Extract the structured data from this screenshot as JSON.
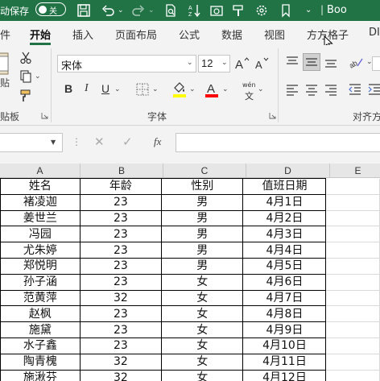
{
  "titlebar": {
    "autosave_label": "动保存",
    "toggle_label": "关",
    "doc_name": "Boo"
  },
  "tabs": [
    {
      "label": "件"
    },
    {
      "label": "开始"
    },
    {
      "label": "插入"
    },
    {
      "label": "页面布局"
    },
    {
      "label": "公式"
    },
    {
      "label": "数据"
    },
    {
      "label": "视图"
    },
    {
      "label": "方方格子"
    },
    {
      "label": "DI"
    }
  ],
  "ribbon": {
    "clipboard_paste": "贴",
    "clipboard_group": "贴板",
    "font_name": "宋体",
    "font_size": "12",
    "font_group": "字体",
    "align_group": "对齐方",
    "phonetic_label": "wén",
    "phonetic_sub": "文"
  },
  "formula_bar": {
    "fx_label": "fx",
    "value": ""
  },
  "columns": [
    "A",
    "B",
    "C",
    "D",
    "E"
  ],
  "table": {
    "headers": [
      "姓名",
      "年龄",
      "性别",
      "值班日期"
    ],
    "rows": [
      [
        "褚凌迦",
        "23",
        "男",
        "4月1日"
      ],
      [
        "姜世兰",
        "23",
        "男",
        "4月2日"
      ],
      [
        "冯园",
        "23",
        "男",
        "4月3日"
      ],
      [
        "尤朱婷",
        "23",
        "男",
        "4月4日"
      ],
      [
        "郑悦明",
        "23",
        "男",
        "4月5日"
      ],
      [
        "孙子涵",
        "23",
        "女",
        "4月6日"
      ],
      [
        "范黄萍",
        "32",
        "女",
        "4月7日"
      ],
      [
        "赵枫",
        "23",
        "女",
        "4月8日"
      ],
      [
        "施黛",
        "23",
        "女",
        "4月9日"
      ],
      [
        "水子鑫",
        "23",
        "女",
        "4月10日"
      ],
      [
        "陶青槐",
        "32",
        "女",
        "4月11日"
      ],
      [
        "施湫芬",
        "32",
        "女",
        "4月12日"
      ]
    ]
  },
  "colors": {
    "title_bar": "#217346",
    "ribbon_bg": "#f3f3f3",
    "fill_yellow": "#ffff00",
    "font_red": "#ff0000"
  }
}
